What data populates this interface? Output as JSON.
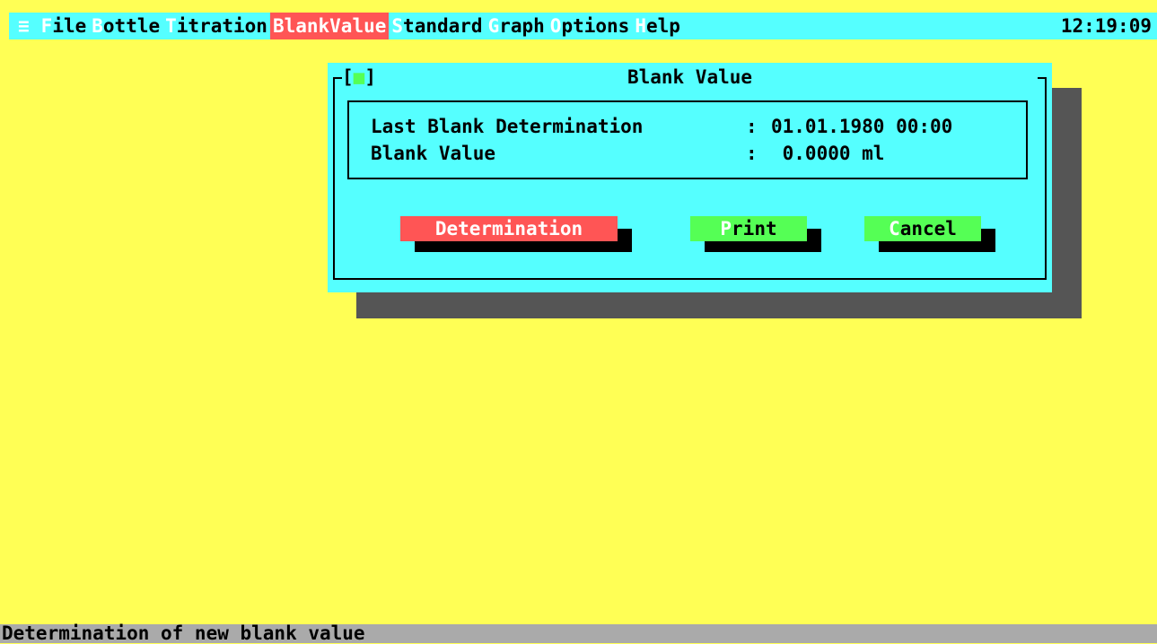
{
  "menubar": {
    "system_icon": "≡",
    "items": [
      {
        "hotkey": "F",
        "rest": "ile"
      },
      {
        "hotkey": "B",
        "rest": "ottle"
      },
      {
        "hotkey": "T",
        "rest": "itration"
      },
      {
        "hotkey": "B",
        "rest": "lankValue"
      },
      {
        "hotkey": "S",
        "rest": "tandard"
      },
      {
        "hotkey": "G",
        "rest": "raph"
      },
      {
        "hotkey": "O",
        "rest": "ptions"
      },
      {
        "hotkey": "H",
        "rest": "elp"
      }
    ],
    "active_index": 3,
    "clock": "12:19:09"
  },
  "dialog": {
    "title": "Blank Value",
    "close_left": "[",
    "close_mark": "■",
    "close_right": "]",
    "rows": [
      {
        "label": "Last Blank Determination",
        "sep": ":",
        "value": "01.01.1980 00:00"
      },
      {
        "label": "Blank Value",
        "sep": ":",
        "value": " 0.0000 ml"
      }
    ],
    "buttons": {
      "determination": "Determination",
      "print_hotkey": "P",
      "print_rest": "rint",
      "cancel_hotkey": "C",
      "cancel_rest": "ancel"
    }
  },
  "statusbar": {
    "text": "Determination of new blank value"
  },
  "colors": {
    "desktop": "#ffff55",
    "menubar": "#55ffff",
    "active": "#ff5555",
    "button_green": "#55ff55",
    "shadow": "#555555",
    "status": "#aaaaaa"
  }
}
